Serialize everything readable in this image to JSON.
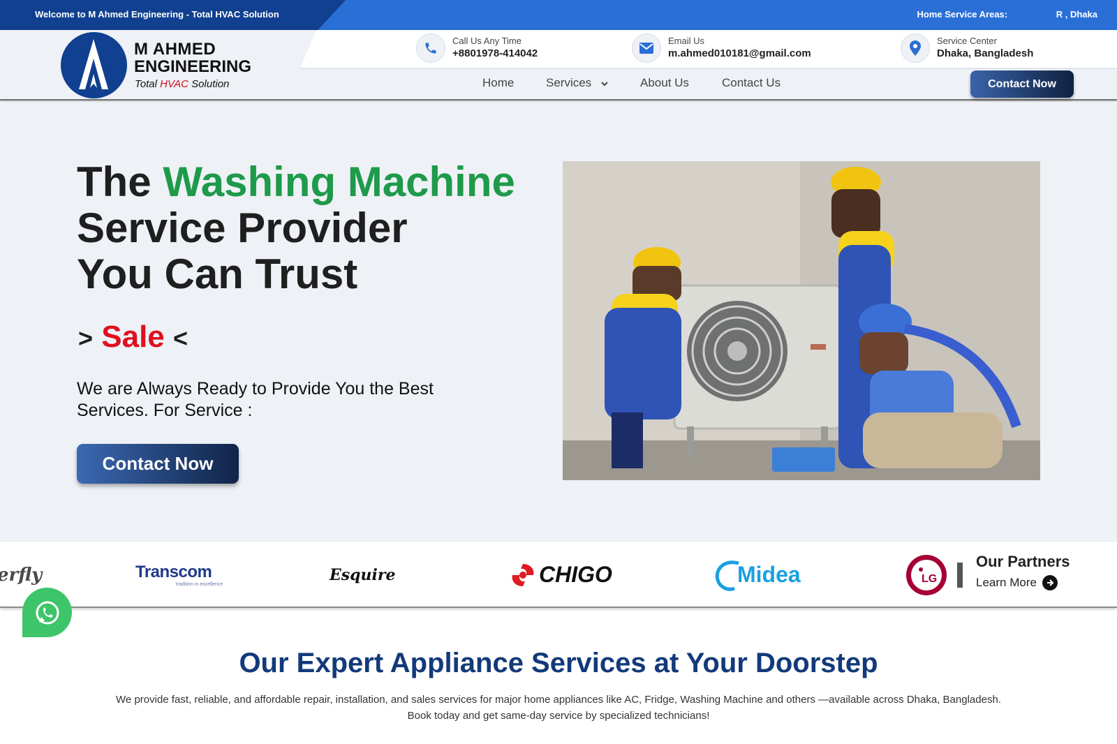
{
  "topbar": {
    "welcome": "Welcome to M Ahmed Engineering - Total HVAC Solution",
    "service_areas_label": "Home Service Areas:",
    "service_areas_value": "R   , Dhaka"
  },
  "logo": {
    "line1": "M  AHMED",
    "line2": "ENGINEERING",
    "tag_pre": "Total ",
    "tag_red": "HVAC",
    "tag_post": " Solution"
  },
  "contacts": [
    {
      "label": "Call Us Any Time",
      "value": "+8801978-414042",
      "icon": "phone-icon"
    },
    {
      "label": "Email Us",
      "value": "m.ahmed010181@gmail.com",
      "icon": "envelope-icon"
    },
    {
      "label": "Service Center",
      "value": "Dhaka, Bangladesh",
      "icon": "location-pin-icon"
    }
  ],
  "nav": {
    "home": "Home",
    "services": "Services",
    "about": "About Us",
    "contact": "Contact Us",
    "cta": "Contact Now"
  },
  "hero": {
    "title_pre": "The ",
    "title_green": "Washing Machine",
    "title_line2": "Service Provider",
    "title_line3": "You Can Trust",
    "arrow_left": ">",
    "typed_word": "Sale",
    "arrow_right": "<",
    "subtitle": "We are Always Ready to Provide You the Best Services. For Service :",
    "cta": "Contact Now",
    "image_alt": "technicians-servicing-ac-outdoor-unit"
  },
  "partners": {
    "brands": [
      "erfly",
      "Transcom",
      "Esquire",
      "CHIGO",
      "Midea",
      "LG"
    ],
    "transcom_tagline": "tradition in excellence",
    "title": "Our Partners",
    "learn_more": "Learn More"
  },
  "services_section": {
    "title": "Our Expert Appliance Services at Your Doorstep",
    "description": "We provide fast, reliable, and affordable repair, installation, and sales services for major home appliances like AC, Fridge, Washing Machine and others —available across Dhaka, Bangladesh. Book today and get same-day service by specialized technicians!"
  },
  "colors": {
    "brand_dark_blue": "#10408f",
    "topbar_blue": "#2a6fd6",
    "accent_green": "#1e9a4a",
    "accent_red": "#e0101e",
    "heading_blue": "#123a7a",
    "whatsapp_green": "#3ec56a"
  }
}
